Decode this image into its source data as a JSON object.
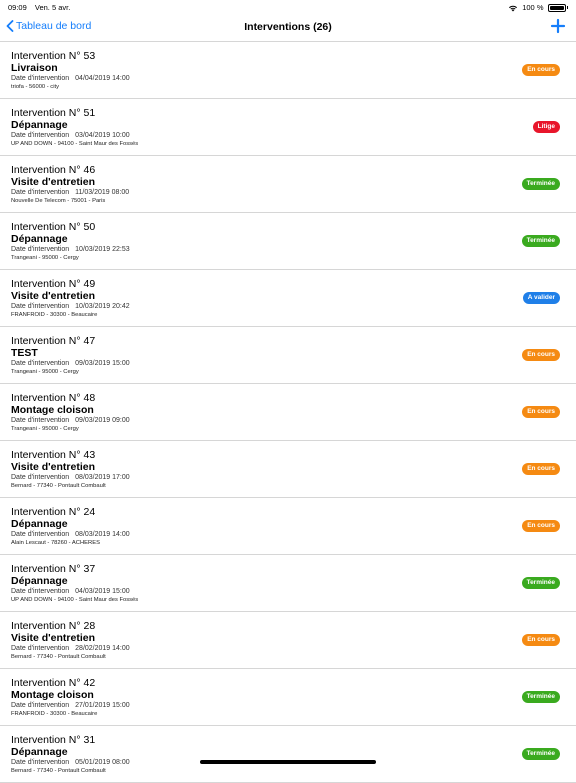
{
  "status_bar": {
    "time": "09:09",
    "date": "Ven. 5 avr.",
    "battery": "100 %"
  },
  "nav": {
    "back_label": "Tableau de bord",
    "title": "Interventions (26)",
    "add_icon": "plus-icon",
    "accent_color": "#157efb"
  },
  "colors": {
    "en_cours": "#f58a12",
    "litige": "#e8162b",
    "terminee": "#3aaa1f",
    "a_valider": "#1f7fe8"
  },
  "interventions": [
    {
      "title": "Intervention N° 53",
      "type": "Livraison",
      "date_label": "Date d'intervention",
      "date": "04/04/2019 14:00",
      "address": "triofa  -  56000  -  city",
      "status": "En cours",
      "status_key": "encours"
    },
    {
      "title": "Intervention N° 51",
      "type": "Dépannage",
      "date_label": "Date d'intervention",
      "date": "03/04/2019 10:00",
      "address": "UP AND DOWN  -  94100  -  Saint Maur des Fossés",
      "status": "Litige",
      "status_key": "litige"
    },
    {
      "title": "Intervention N° 46",
      "type": "Visite d'entretien",
      "date_label": "Date d'intervention",
      "date": "11/03/2019 08:00",
      "address": "Nouvelle De Telecom  -  75001  -  Paris",
      "status": "Terminée",
      "status_key": "terminee"
    },
    {
      "title": "Intervention N° 50",
      "type": "Dépannage",
      "date_label": "Date d'intervention",
      "date": "10/03/2019 22:53",
      "address": "Trangeani  -  95000  -  Cergy",
      "status": "Terminée",
      "status_key": "terminee"
    },
    {
      "title": "Intervention N° 49",
      "type": "Visite d'entretien",
      "date_label": "Date d'intervention",
      "date": "10/03/2019 20:42",
      "address": "FRANFROID  -  30300  -  Beaucaire",
      "status": "A valider",
      "status_key": "avalider"
    },
    {
      "title": "Intervention N° 47",
      "type": "TEST",
      "date_label": "Date d'intervention",
      "date": "09/03/2019 15:00",
      "address": "Trangeani  -  95000  -  Cergy",
      "status": "En cours",
      "status_key": "encours"
    },
    {
      "title": "Intervention N° 48",
      "type": "Montage cloison",
      "date_label": "Date d'intervention",
      "date": "09/03/2019 09:00",
      "address": "Trangeani  -  95000  -  Cergy",
      "status": "En cours",
      "status_key": "encours"
    },
    {
      "title": "Intervention N° 43",
      "type": "Visite d'entretien",
      "date_label": "Date d'intervention",
      "date": "08/03/2019 17:00",
      "address": "Bernard  -  77340  -  Pontault Combault",
      "status": "En cours",
      "status_key": "encours"
    },
    {
      "title": "Intervention N° 24",
      "type": "Dépannage",
      "date_label": "Date d'intervention",
      "date": "08/03/2019 14:00",
      "address": "Alain Lescaut  -  78260  -  ACHERES",
      "status": "En cours",
      "status_key": "encours"
    },
    {
      "title": "Intervention N° 37",
      "type": "Dépannage",
      "date_label": "Date d'intervention",
      "date": "04/03/2019 15:00",
      "address": "UP AND DOWN  -  94100  -  Saint Maur des Fossés",
      "status": "Terminée",
      "status_key": "terminee"
    },
    {
      "title": "Intervention N° 28",
      "type": "Visite d'entretien",
      "date_label": "Date d'intervention",
      "date": "28/02/2019 14:00",
      "address": "Bernard  -  77340  -  Pontault Combault",
      "status": "En cours",
      "status_key": "encours"
    },
    {
      "title": "Intervention N° 42",
      "type": "Montage cloison",
      "date_label": "Date d'intervention",
      "date": "27/01/2019 15:00",
      "address": "FRANFROID  -  30300  -  Beaucaire",
      "status": "Terminée",
      "status_key": "terminee"
    },
    {
      "title": "Intervention N° 31",
      "type": "Dépannage",
      "date_label": "Date d'intervention",
      "date": "05/01/2019 08:00",
      "address": "Bernard  -  77340  -  Pontault Combault",
      "status": "Terminée",
      "status_key": "terminee"
    }
  ]
}
